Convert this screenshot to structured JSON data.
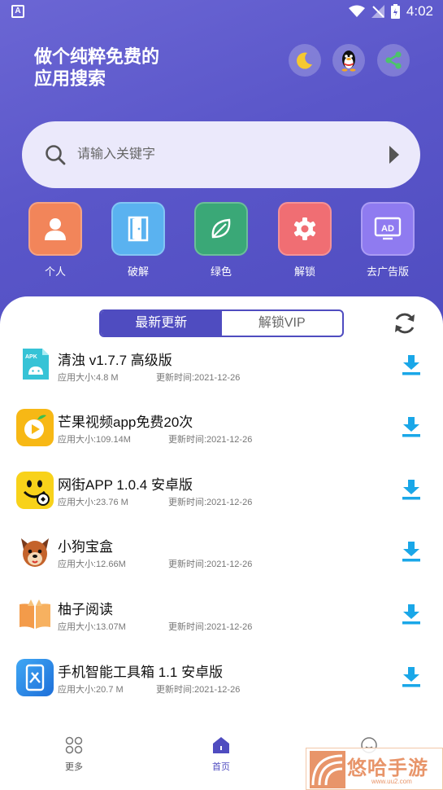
{
  "status_bar": {
    "time": "4:02",
    "app_badge": "A"
  },
  "header": {
    "line1": "做个纯粹免费的",
    "line2": "应用搜索",
    "buttons": [
      {
        "name": "night-mode",
        "icon": "moon-icon"
      },
      {
        "name": "qq",
        "icon": "qq-penguin-icon"
      },
      {
        "name": "share",
        "icon": "share-icon"
      }
    ]
  },
  "search": {
    "placeholder": "请输入关键字",
    "value": ""
  },
  "categories": [
    {
      "label": "个人",
      "color": "#f2855a",
      "icon": "person-icon"
    },
    {
      "label": "破解",
      "color": "#5ab2f0",
      "icon": "door-icon"
    },
    {
      "label": "绿色",
      "color": "#3aa877",
      "icon": "leaf-icon"
    },
    {
      "label": "解锁",
      "color": "#f06e73",
      "icon": "gear-icon"
    },
    {
      "label": "去广告版",
      "color": "#8f7bf0",
      "icon": "ad-icon"
    }
  ],
  "tabs": {
    "items": [
      "最新更新",
      "解锁VIP"
    ],
    "active": 0
  },
  "apps": [
    {
      "name": "清浊 v1.7.7 高级版",
      "size": "应用大小:4.8 M",
      "date": "更新时间:2021-12-26"
    },
    {
      "name": "芒果视频app免费20次",
      "size": "应用大小:109.14M",
      "date": "更新时间:2021-12-26"
    },
    {
      "name": "网街APP 1.0.4 安卓版",
      "size": "应用大小:23.76 M",
      "date": "更新时间:2021-12-26"
    },
    {
      "name": "小狗宝盒",
      "size": "应用大小:12.66M",
      "date": "更新时间:2021-12-26"
    },
    {
      "name": "柚子阅读",
      "size": "应用大小:13.07M",
      "date": "更新时间:2021-12-26"
    },
    {
      "name": "手机智能工具箱 1.1 安卓版",
      "size": "应用大小:20.7 M",
      "date": "更新时间:2021-12-26"
    }
  ],
  "tabbar": [
    {
      "label": "更多",
      "icon": "grid-icon"
    },
    {
      "label": "首页",
      "icon": "home-icon"
    },
    {
      "label": "",
      "icon": "smiley-icon"
    }
  ],
  "watermark": {
    "text": "悠哈手游",
    "sub": "www.uu2.com"
  },
  "colors": {
    "primary": "#4f4cc0",
    "download": "#1aa7e8"
  }
}
